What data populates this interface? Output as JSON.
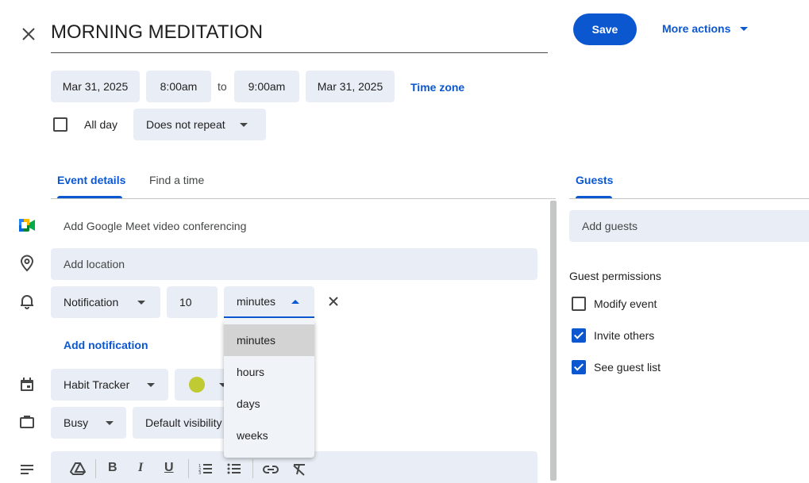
{
  "header": {
    "title": "MORNING MEDITATION",
    "save_label": "Save",
    "more_actions_label": "More actions"
  },
  "datetime": {
    "start_date": "Mar 31, 2025",
    "start_time": "8:00am",
    "to_label": "to",
    "end_time": "9:00am",
    "end_date": "Mar 31, 2025",
    "time_zone_label": "Time zone",
    "all_day_label": "All day",
    "all_day_checked": false,
    "repeat_value": "Does not repeat"
  },
  "tabs": {
    "event_details": "Event details",
    "find_a_time": "Find a time",
    "active": "event_details"
  },
  "details": {
    "meet_label": "Add Google Meet video conferencing",
    "location_placeholder": "Add location",
    "notification_type": "Notification",
    "notification_amount": "10",
    "notification_unit": "minutes",
    "add_notification_label": "Add notification",
    "calendar_name": "Habit Tracker",
    "calendar_color": "#c0ca33",
    "busy_value": "Busy",
    "visibility_value": "Default visibility"
  },
  "unit_menu": {
    "options": [
      "minutes",
      "hours",
      "days",
      "weeks"
    ],
    "selected_index": 0
  },
  "toolbar_icons": [
    "drive-icon",
    "bold-icon",
    "italic-icon",
    "underline-icon",
    "numbered-list-icon",
    "bulleted-list-icon",
    "link-icon",
    "clear-formatting-icon"
  ],
  "guests": {
    "tab_label": "Guests",
    "add_guests_placeholder": "Add guests",
    "permissions_title": "Guest permissions",
    "permissions": [
      {
        "label": "Modify event",
        "checked": false
      },
      {
        "label": "Invite others",
        "checked": true
      },
      {
        "label": "See guest list",
        "checked": true
      }
    ]
  },
  "colors": {
    "accent": "#0b57d0",
    "chip_bg": "#e9eef6",
    "menu_selected": "#d3d3d3"
  }
}
